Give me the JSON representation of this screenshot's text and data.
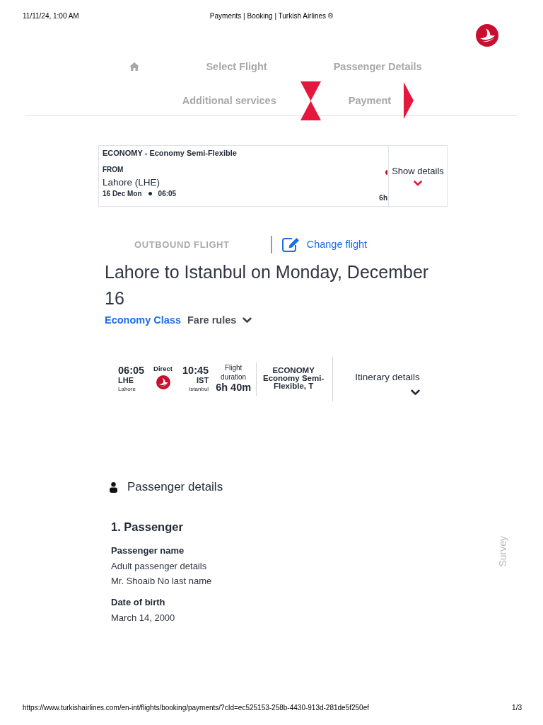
{
  "print_header": {
    "date": "11/11/24, 1:00 AM",
    "title": "Payments | Booking | Turkish Airlines ®"
  },
  "steps": [
    {
      "kind": "home",
      "selected": false
    },
    {
      "kind": "step",
      "label": "Select Flight",
      "selected": false
    },
    {
      "kind": "step",
      "label": "Passenger Details",
      "selected": false
    },
    {
      "kind": "step",
      "label": "Additional services",
      "selected": false
    },
    {
      "kind": "step",
      "label": "Payment",
      "selected": true
    }
  ],
  "summary": {
    "fare": "ECONOMY - Economy Semi-Flexible",
    "from_label": "FROM",
    "origin": "Lahore (LHE)",
    "date": "16 Dec Mon",
    "time": "06:05",
    "duration": "6h",
    "show_details": {
      "label": "Show details",
      "expanded": false
    }
  },
  "outbound": {
    "label": "OUTBOUND FLIGHT",
    "change_link": "Change flight"
  },
  "heading": "Lahore to Istanbul on Monday, December 16",
  "fare_row": {
    "cabin_class": "Economy Class",
    "fare_rules": {
      "label": "Fare rules",
      "expanded": false
    }
  },
  "flight": {
    "departure_time": "06:05",
    "departure_code": "LHE",
    "departure_city": "Lahore",
    "stops": "Direct",
    "arrival_time": "10:45",
    "arrival_code": "IST",
    "arrival_city": "Istanbul",
    "duration_label": "Flight duration",
    "duration": "6h 40m",
    "cabin": "ECONOMY",
    "fare": "Economy Semi-Flexible, T",
    "itinerary": {
      "label": "Itinerary details",
      "expanded": false
    }
  },
  "passenger_details": {
    "title": "Passenger details",
    "passengers": [
      {
        "title": "1. Passenger",
        "fields": [
          {
            "label": "Passenger name",
            "values": [
              "Adult passenger details",
              "Mr. Shoaib No last name"
            ]
          },
          {
            "label": "Date of birth",
            "values": [
              "March 14, 2000"
            ]
          }
        ]
      }
    ]
  },
  "survey": "Survey",
  "footer": {
    "url": "https://www.turkishairlines.com/en-int/flights/booking/payments/?cId=ec525153-258b-4430-913d-281de5f250ef",
    "page": "1/3"
  }
}
